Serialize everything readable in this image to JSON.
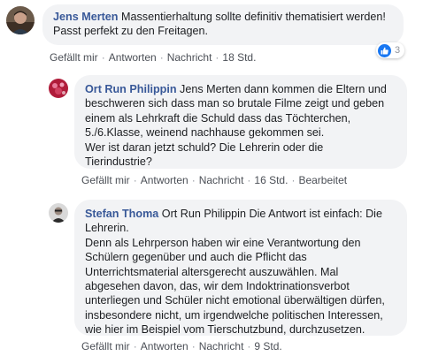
{
  "comments": [
    {
      "author": "Jens Merten",
      "text_lines": [
        "Massentierhaltung sollte definitiv thematisiert werden!",
        "Passt perfekt zu den Freitagen."
      ],
      "actions": {
        "like": "Gefällt mir",
        "reply": "Antworten",
        "message": "Nachricht",
        "time": "18 Std."
      },
      "reaction_count": "3",
      "reaction_icon": "like-icon",
      "avatar_icon": "profile-photo-jens"
    },
    {
      "author": "Ort Run Philippin",
      "text_lines": [
        "Jens Merten dann kommen die Eltern und",
        "beschweren sich dass man so brutale Filme zeigt und geben",
        "einem als Lehrkraft die Schuld dass das Töchterchen,",
        "5./6.Klasse, weinend nachhause gekommen sei.",
        "Wer ist daran jetzt schuld? Die Lehrerin oder die",
        "Tierindustrie?"
      ],
      "actions": {
        "like": "Gefällt mir",
        "reply": "Antworten",
        "message": "Nachricht",
        "time": "16 Std.",
        "edited": "Bearbeitet"
      },
      "avatar_icon": "profile-photo-philippin"
    },
    {
      "author": "Stefan Thoma",
      "text_lines": [
        "Ort Run Philippin Die Antwort ist einfach: Die",
        "Lehrerin.",
        "Denn als Lehrperson haben wir eine Verantwortung den",
        "Schülern gegenüber und auch die Pflicht das",
        "Unterrichtsmaterial altersgerecht auszuwählen. Mal",
        "abgesehen davon, das, wir dem Indoktrinationsverbot",
        "unterliegen und Schüler nicht emotional überwältigen dürfen,",
        "insbesondere nicht, um irgendwelche politischen Interessen,",
        "wie hier im Beispiel vom Tierschutzbund, durchzusetzen."
      ],
      "actions": {
        "like": "Gefällt mir",
        "reply": "Antworten",
        "message": "Nachricht",
        "time": "9 Std."
      },
      "avatar_icon": "profile-photo-stefan"
    }
  ],
  "colors": {
    "name": "#385898",
    "bubble": "#f2f3f5",
    "meta": "#90949c",
    "like_blue": "#1877f2"
  }
}
